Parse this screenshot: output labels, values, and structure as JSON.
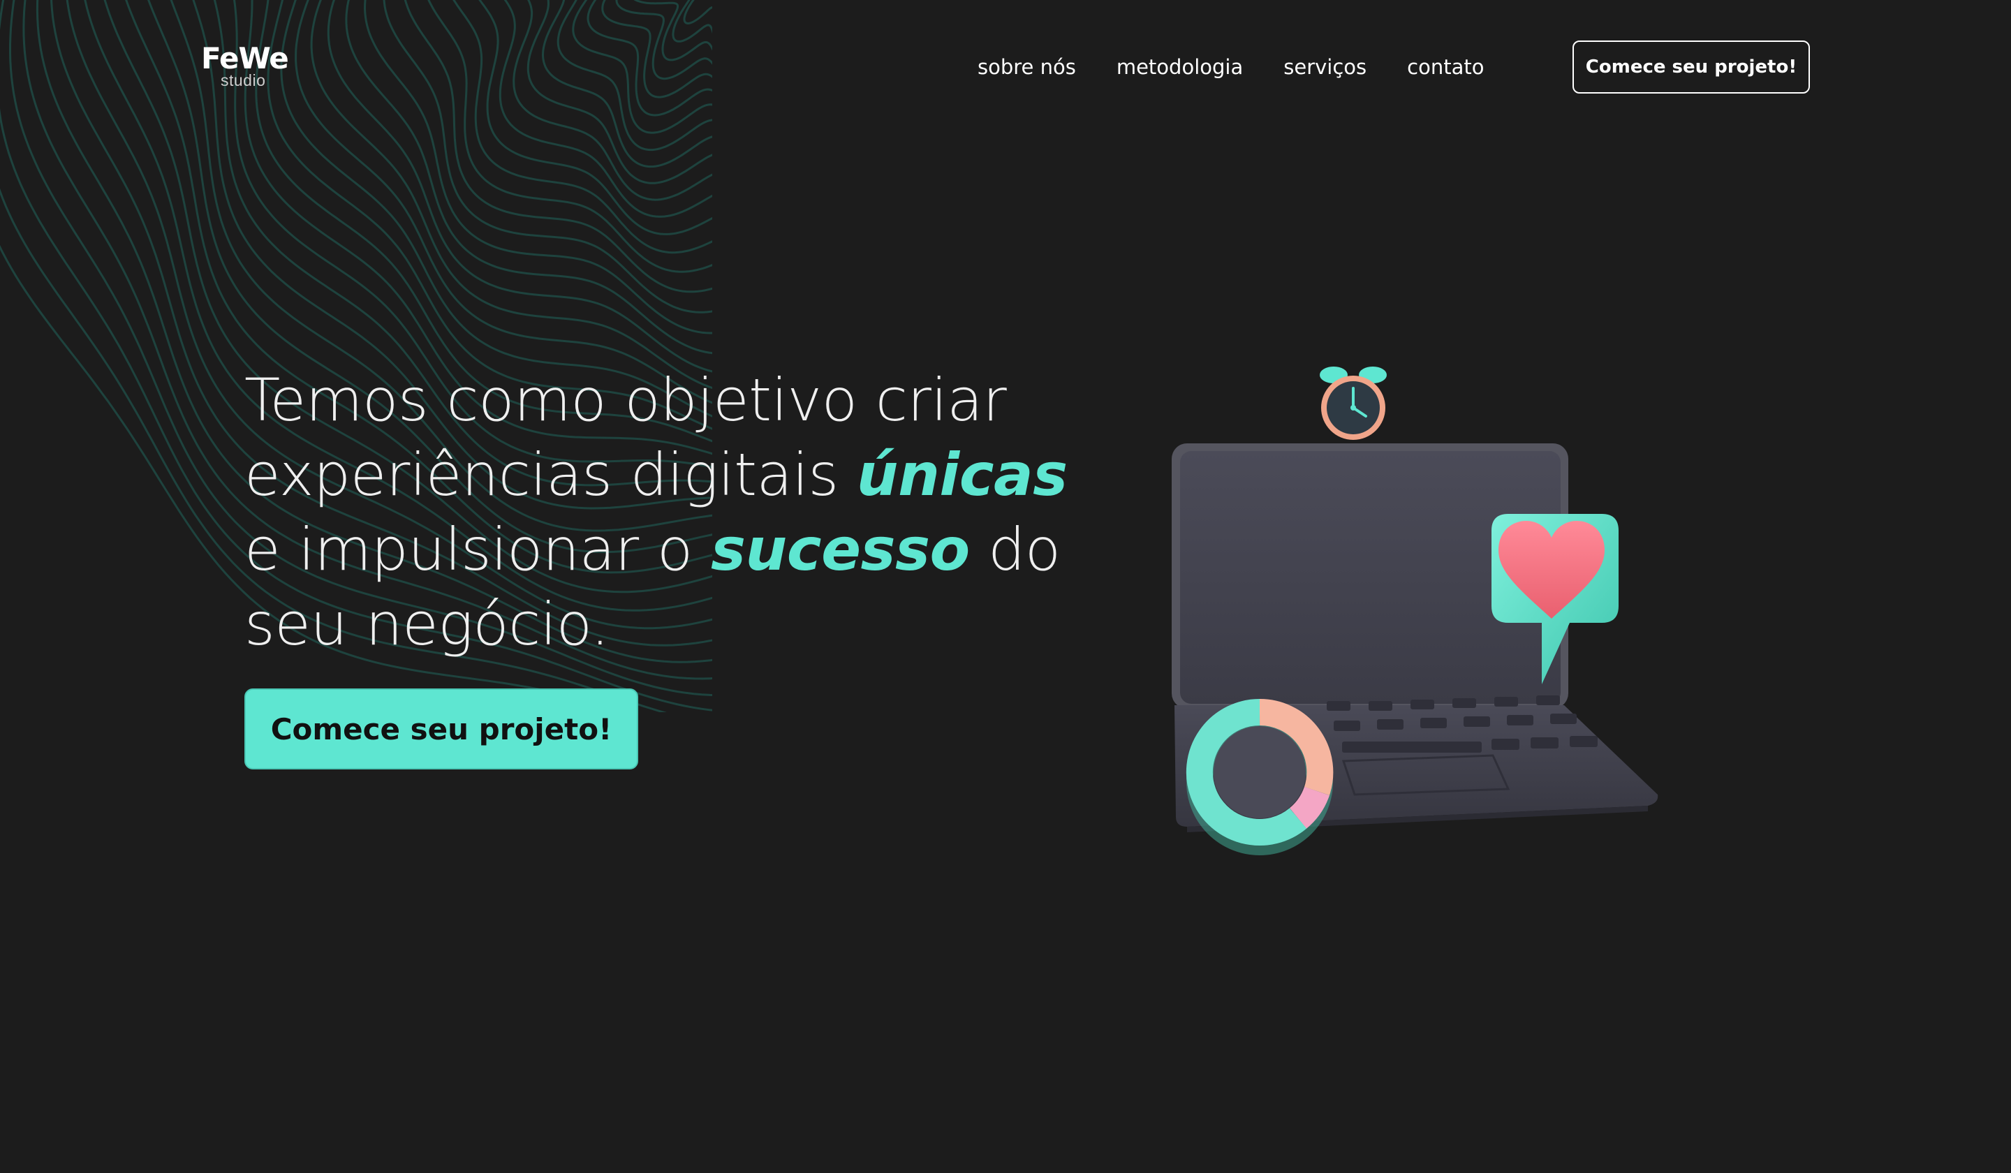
{
  "logo": {
    "main": "FeWe",
    "sub": "studio"
  },
  "nav": {
    "items": [
      {
        "label": "sobre nós"
      },
      {
        "label": "metodologia"
      },
      {
        "label": "serviços"
      },
      {
        "label": "contato"
      }
    ],
    "cta_label": "Comece seu projeto!"
  },
  "hero": {
    "line1": "Temos como objetivo criar",
    "line2_a": "experiências digitais",
    "line2_hl": "únicas",
    "line3_a": "e impulsionar o",
    "line3_hl": "sucesso",
    "line3_b": "do",
    "line4": "seu negócio.",
    "cta_label": "Comece seu projeto!"
  },
  "colors": {
    "background": "#1c1c1c",
    "accent": "#5ee6d1",
    "wave": "#1f4a44",
    "text": "#ffffff"
  },
  "icons": {
    "illustration": "laptop-3d-illustration",
    "clock": "alarm-clock-icon",
    "heart": "heart-speech-bubble-icon",
    "donut": "donut-chart-icon"
  }
}
